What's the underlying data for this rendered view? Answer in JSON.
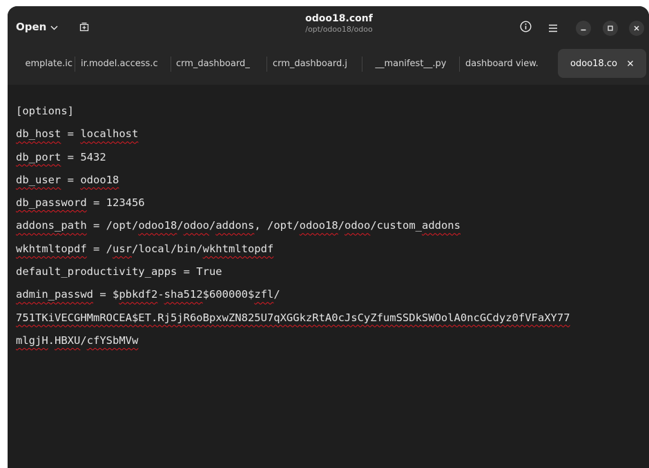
{
  "window": {
    "title": "odoo18.conf",
    "subtitle": "/opt/odoo18/odoo",
    "open_label": "Open",
    "icons": [
      "chevron-down-icon",
      "new-tab-icon",
      "info-icon",
      "menu-icon",
      "minimize-icon",
      "maximize-icon",
      "close-icon"
    ]
  },
  "tabs": [
    {
      "label": "emplate.ic"
    },
    {
      "label": "ir.model.access.c"
    },
    {
      "label": "crm_dashboard_"
    },
    {
      "label": "crm_dashboard.j"
    },
    {
      "label": "__manifest__.py"
    },
    {
      "label": "dashboard view."
    },
    {
      "label": "odoo18.co",
      "active": true
    }
  ],
  "editor": {
    "lines": [
      [
        {
          "t": "[options]"
        }
      ],
      [
        {
          "t": "db_host",
          "s": 1
        },
        {
          "t": " = "
        },
        {
          "t": "localhost",
          "s": 1
        }
      ],
      [
        {
          "t": "db_port",
          "s": 1
        },
        {
          "t": " = 5432"
        }
      ],
      [
        {
          "t": "db_user",
          "s": 1
        },
        {
          "t": " = "
        },
        {
          "t": "odoo18",
          "s": 1
        }
      ],
      [
        {
          "t": "db_password",
          "s": 1
        },
        {
          "t": " = 123456"
        }
      ],
      [
        {
          "t": "addons_path",
          "s": 1
        },
        {
          "t": " = /opt/"
        },
        {
          "t": "odoo18",
          "s": 1
        },
        {
          "t": "/"
        },
        {
          "t": "odoo",
          "s": 1
        },
        {
          "t": "/"
        },
        {
          "t": "addons",
          "s": 1
        },
        {
          "t": ", /opt/"
        },
        {
          "t": "odoo18",
          "s": 1
        },
        {
          "t": "/"
        },
        {
          "t": "odoo",
          "s": 1
        },
        {
          "t": "/custom_"
        },
        {
          "t": "addons",
          "s": 1
        }
      ],
      [
        {
          "t": "wkhtmltopdf",
          "s": 1
        },
        {
          "t": " = /"
        },
        {
          "t": "usr",
          "s": 1
        },
        {
          "t": "/local/bin/"
        },
        {
          "t": "wkhtmltopdf",
          "s": 1
        }
      ],
      [
        {
          "t": "default_productivity_apps = True"
        }
      ],
      [
        {
          "t": "admin_passwd",
          "s": 1
        },
        {
          "t": " = $"
        },
        {
          "t": "pbkdf2",
          "s": 1
        },
        {
          "t": "-"
        },
        {
          "t": "sha512",
          "s": 1
        },
        {
          "t": "$600000$"
        },
        {
          "t": "zfl",
          "s": 1
        },
        {
          "t": "/"
        }
      ],
      [
        {
          "t": "751TKiVECGHMmROCEA$ET.Rj5jR6oBpxwZN825U7qXGGkzRtA0cJsCyZfumSSDkSWOolA0ncGCdyz0fVFaXY77",
          "s": 1
        }
      ],
      [
        {
          "t": "mlgjH",
          "s": 1
        },
        {
          "t": "."
        },
        {
          "t": "HBXU",
          "s": 1
        },
        {
          "t": "/"
        },
        {
          "t": "cfYSbMVw",
          "s": 1
        }
      ]
    ]
  }
}
